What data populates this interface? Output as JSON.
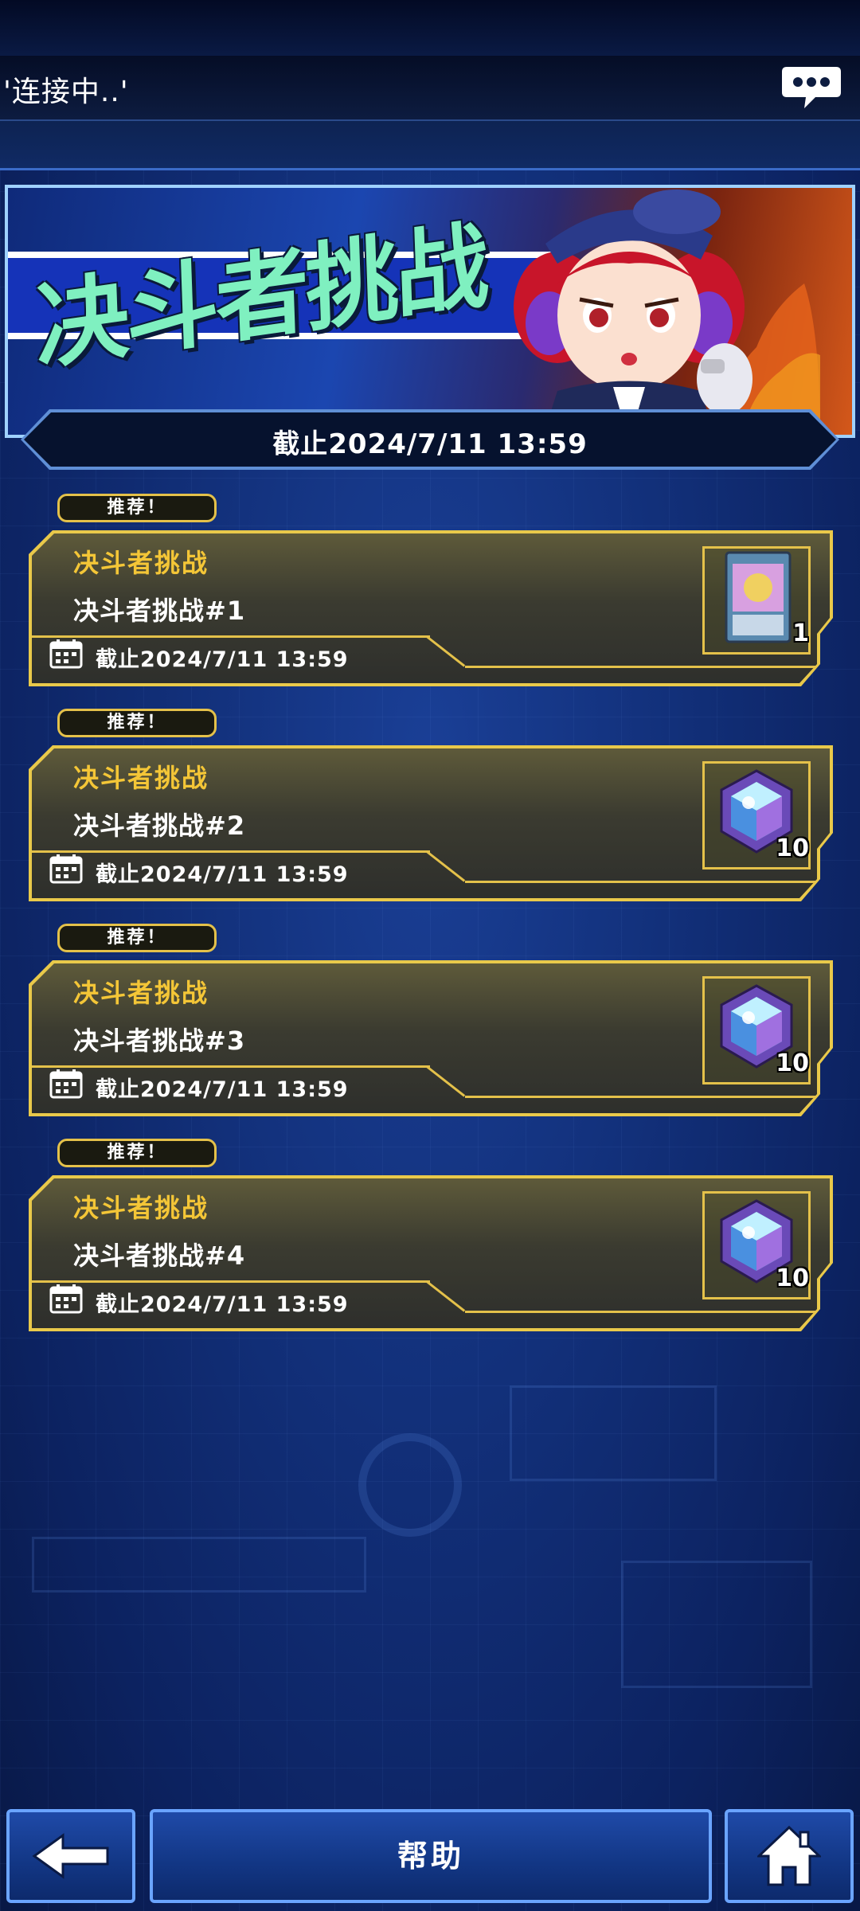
{
  "status_bar": {
    "connecting_text": "'连接中..'"
  },
  "banner": {
    "title": "决斗者挑战",
    "deadline": "截止2024/7/11 13:59"
  },
  "events": [
    {
      "badge": "推荐！",
      "category": "决斗者挑战",
      "title": "决斗者挑战#1",
      "deadline": "截止2024/7/11 13:59",
      "reward_icon": "card-icon",
      "reward_count": "1"
    },
    {
      "badge": "推荐！",
      "category": "决斗者挑战",
      "title": "决斗者挑战#2",
      "deadline": "截止2024/7/11 13:59",
      "reward_icon": "gem-icon",
      "reward_count": "10"
    },
    {
      "badge": "推荐！",
      "category": "决斗者挑战",
      "title": "决斗者挑战#3",
      "deadline": "截止2024/7/11 13:59",
      "reward_icon": "gem-icon",
      "reward_count": "10"
    },
    {
      "badge": "推荐！",
      "category": "决斗者挑战",
      "title": "决斗者挑战#4",
      "deadline": "截止2024/7/11 13:59",
      "reward_icon": "gem-icon",
      "reward_count": "10"
    }
  ],
  "bottom_nav": {
    "back_icon": "arrow-left-icon",
    "help_label": "帮助",
    "home_icon": "home-icon"
  },
  "colors": {
    "accent_gold": "#e4c14a",
    "category_yellow": "#f4c637",
    "background_blue": "#12307a",
    "nav_border": "#6aa4ff"
  }
}
